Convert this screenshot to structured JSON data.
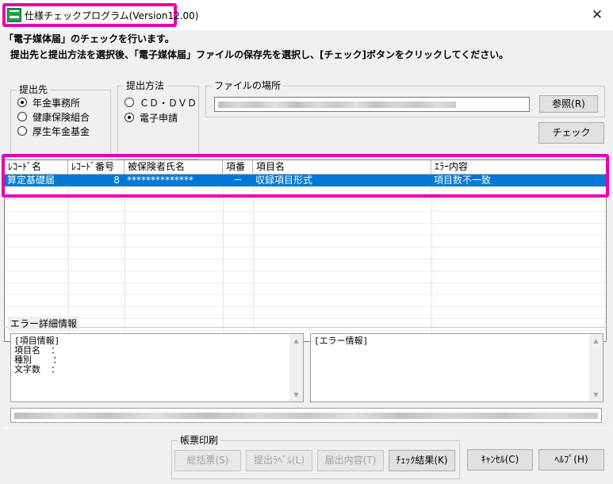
{
  "window": {
    "title": "仕様チェックプログラム(Version12.00)",
    "close_glyph": "✕",
    "icon": "app-icon"
  },
  "instructions": {
    "line1": "「電子媒体届」のチェックを行います。",
    "line2": "提出先と提出方法を選択後、「電子媒体届」ファイルの保存先を選択し、[チェック]ボタンをクリックしてください。"
  },
  "destination": {
    "label": "提出先",
    "options": [
      {
        "label": "年金事務所",
        "checked": true
      },
      {
        "label": "健康保険組合",
        "checked": false
      },
      {
        "label": "厚生年金基金",
        "checked": false
      }
    ]
  },
  "method": {
    "label": "提出方法",
    "options": [
      {
        "label": "ＣＤ・ＤＶＤ",
        "checked": false
      },
      {
        "label": "電子申請",
        "checked": true
      }
    ]
  },
  "file_location": {
    "label": "ファイルの場所",
    "browse_label": "参照(R)"
  },
  "check_button": "チェック",
  "results": {
    "columns": [
      "ﾚｺｰﾄﾞ名",
      "ﾚｺｰﾄﾞ番号",
      "被保険者氏名",
      "項番",
      "項目名",
      "ｴﾗｰ内容"
    ],
    "rows": [
      {
        "record_name": "算定基礎届",
        "record_no": "8",
        "insured_name": "**************",
        "item_no": "－",
        "item_name": "収録項目形式",
        "error": "項目数不一致",
        "selected": true
      }
    ]
  },
  "error_detail": {
    "label": "エラー詳細情報",
    "item_info": "[項目情報]\n項目名  ：\n種別    ：\n文字数  ：",
    "error_info": "[エラー情報]"
  },
  "print_group": {
    "label": "帳票印刷",
    "buttons": [
      {
        "label": "総括票(S)",
        "enabled": false
      },
      {
        "label": "提出ﾗﾍﾞﾙ(L)",
        "enabled": false
      },
      {
        "label": "届出内容(T)",
        "enabled": false
      },
      {
        "label": "ﾁｪｯｸ結果(K)",
        "enabled": true
      }
    ]
  },
  "cancel_button": "ｷｬﾝｾﾙ(C)",
  "help_button": "ﾍﾙﾌﾟ(H)",
  "accent_colors": {
    "highlight": "#e400b4",
    "selection": "#0078d7"
  }
}
